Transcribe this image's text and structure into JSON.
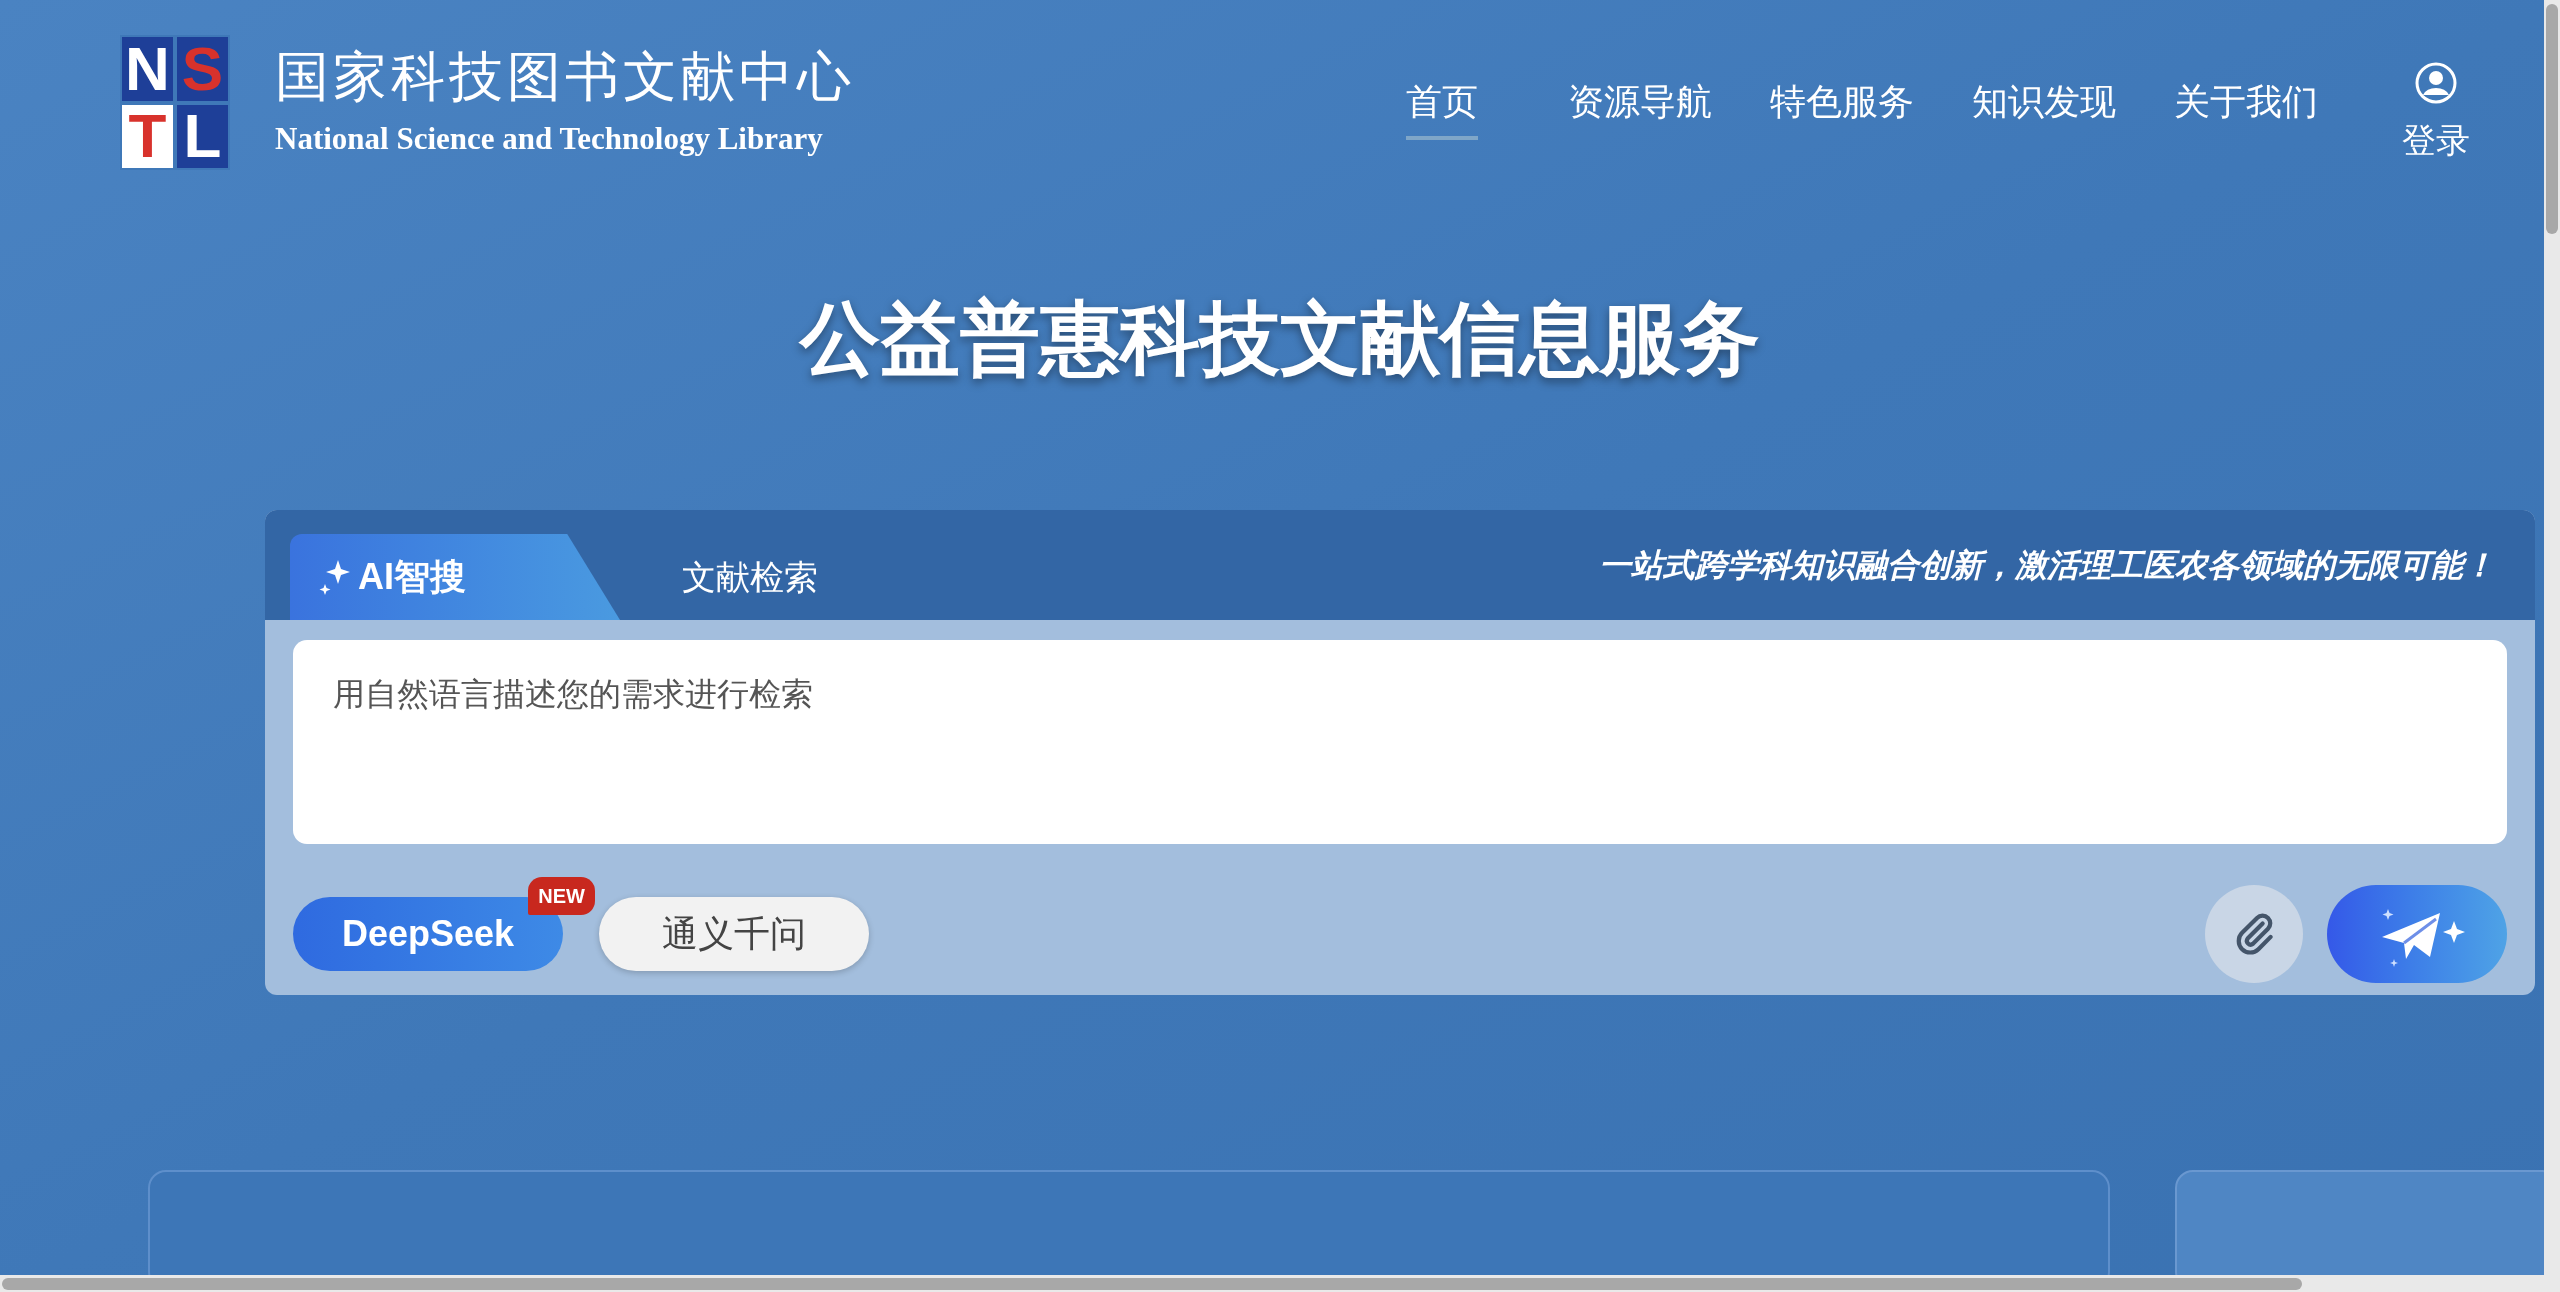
{
  "header": {
    "logo_letters": [
      "N",
      "S",
      "T",
      "L"
    ],
    "title_cn": "国家科技图书文献中心",
    "title_en": "National Science and Technology Library",
    "nav": [
      {
        "label": "首页",
        "selected": true
      },
      {
        "label": "资源导航",
        "selected": false
      },
      {
        "label": "特色服务",
        "selected": false
      },
      {
        "label": "知识发现",
        "selected": false
      },
      {
        "label": "关于我们",
        "selected": false
      }
    ],
    "login": "登录"
  },
  "hero_title": "公益普惠科技文献信息服务",
  "search": {
    "tabs": [
      {
        "label": "AI智搜",
        "selected": true,
        "icon": true
      },
      {
        "label": "文献检索",
        "selected": false,
        "icon": false
      }
    ],
    "slogan": "一站式跨学科知识融合创新，激活理工医农各领域的无限可能！",
    "placeholder": "用自然语言描述您的需求进行检索",
    "models": [
      {
        "label": "DeepSeek",
        "selected": true,
        "badge": "NEW"
      },
      {
        "label": "通义千问",
        "selected": false
      }
    ]
  }
}
